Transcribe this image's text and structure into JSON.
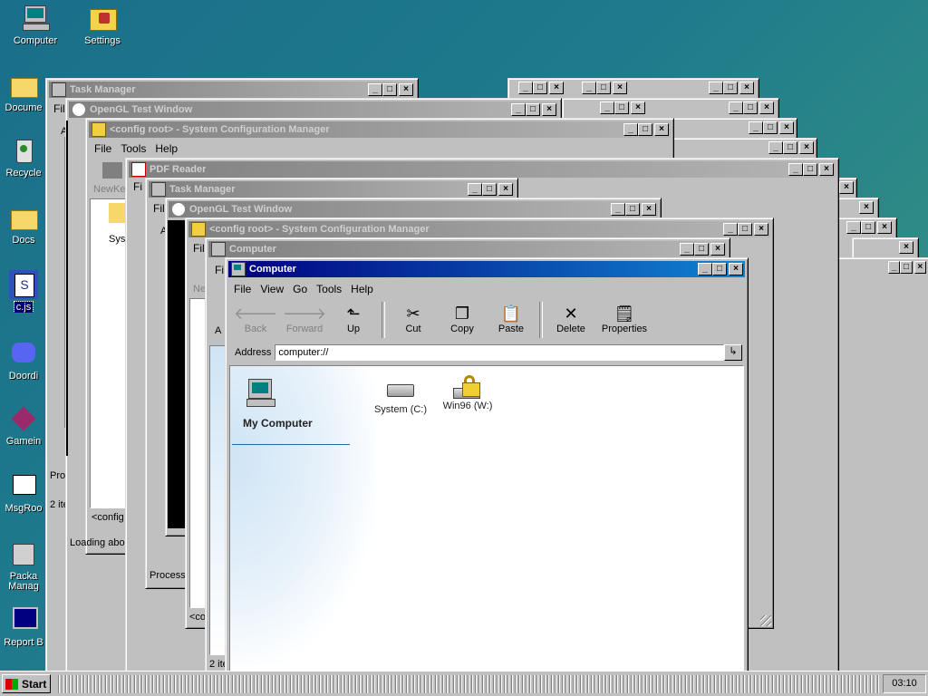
{
  "desktop": {
    "icons": [
      {
        "label": "Computer"
      },
      {
        "label": "Settings"
      },
      {
        "label": "Docume"
      },
      {
        "label": "Recycle"
      },
      {
        "label": "Docs"
      },
      {
        "label": "c.js"
      },
      {
        "label": "Doordi"
      },
      {
        "label": "Gamein"
      },
      {
        "label": "MsgRoo"
      },
      {
        "label": "Packa Manag"
      },
      {
        "label": "Report B"
      }
    ]
  },
  "bg_windows": [
    {
      "title": "Task Manager"
    },
    {
      "title": "OpenGL Test Window"
    },
    {
      "title": "<config root> - System Configuration Manager"
    },
    {
      "title": "PDF Reader"
    },
    {
      "title": "Task Manager"
    },
    {
      "title": "OpenGL Test Window"
    },
    {
      "title": "<config root> - System Configuration Manager"
    },
    {
      "title": "Computer"
    }
  ],
  "bg_text": {
    "menu_file": "File",
    "menu_tools": "Tools",
    "menu_help": "Help",
    "newkey": "NewKe",
    "sys": "Syst",
    "process": "Process",
    "process2": "Process",
    "items": "2 ite",
    "items2": "2 ite",
    "config": "<config",
    "config2": "<co",
    "loading": "Loading abo",
    "fi": "Fi",
    "fil": "Fil",
    "ne": "Ne",
    "a": "A",
    "a2": "A"
  },
  "main_window": {
    "title": "Computer",
    "menu": [
      "File",
      "View",
      "Go",
      "Tools",
      "Help"
    ],
    "toolbar": {
      "back": "Back",
      "forward": "Forward",
      "up": "Up",
      "cut": "Cut",
      "copy": "Copy",
      "paste": "Paste",
      "delete": "Delete",
      "properties": "Properties"
    },
    "address_label": "Address",
    "address_value": "computer://",
    "heading": "My Computer",
    "drives": [
      {
        "label": "System (C:)",
        "icon": "hard-drive-icon"
      },
      {
        "label": "Win96 (W:)",
        "icon": "locked-drive-icon"
      }
    ]
  },
  "taskbar": {
    "start_label": "Start",
    "clock": "03:10"
  },
  "colors": {
    "active_title_start": "#000080",
    "active_title_end": "#1084d0",
    "desktop_bg": "#1e7a8c"
  }
}
